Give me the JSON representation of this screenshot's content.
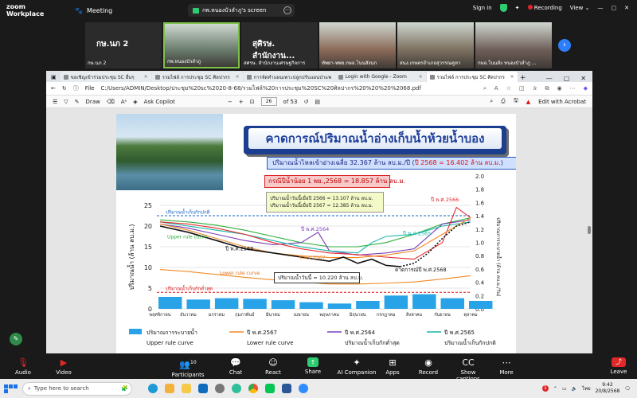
{
  "zoom": {
    "logo_line1": "zoom",
    "logo_line2": "Workplace",
    "meeting_label": "Meeting",
    "screen_pill": "กพ.หนองบัวลำภู's screen",
    "screen_pill_more": "⋯",
    "sign_in": "Sign in",
    "recording": "Recording",
    "view": "View",
    "next_arrow": "›"
  },
  "participants": [
    {
      "name": "กษ.นภ 2",
      "big": "กษ.นภ 2",
      "cam": false
    },
    {
      "name": "กพ.หนองบัวลำภู",
      "big": "",
      "cam": true,
      "active": true
    },
    {
      "name": "สศรษ. สำนักงานเศรษฐกิจการ",
      "big": "สุศิรษ. สำนักงาน...",
      "cam": false
    },
    {
      "name": "ทัพยา-ทพย.กษอ.โนนสังนก",
      "big": "",
      "cam": true
    },
    {
      "name": "สนง.เกษตรอำเภอสุวรรณคูหา",
      "big": "",
      "cam": true
    },
    {
      "name": "กษอ.โนนสัง หนองบัวลำภู ...",
      "big": "",
      "cam": true
    }
  ],
  "browser": {
    "tabs": [
      {
        "label": "ขอเชิญเข้าร่วมประชุม SC อื่นๆ",
        "active": false
      },
      {
        "label": "รวมไฟล์ การประชุม SC ศิลปากร",
        "active": false
      },
      {
        "label": "การจัดทำแผนเพาะปลูกปรับแผนป่าแพ",
        "active": false
      },
      {
        "label": "Login with Google - Zoom",
        "active": false
      },
      {
        "label": "รวมไฟล์ การประชุม SC ศิลปากร",
        "active": true
      }
    ],
    "url_label": "File",
    "url": "C:/Users/ADMIN/Desktop/ประชุม%20sc%2020-8-68/รวมไฟล์%20การประชุม%20SC%20ศิลปากร%20%20%20%2068.pdf",
    "pdf_tools": {
      "draw": "Draw",
      "copilot": "Ask Copilot",
      "page_current": "26",
      "page_total": "of 53",
      "edit_acrobat": "Edit with Acrobat"
    }
  },
  "slide": {
    "title": "คาดการณ์ปริมาณน้ำอ่างเก็บน้ำห้วยน้ำบอง",
    "inflow_note_main": "ปริมาณน้ำไหลเข้าอ่างเฉลี่ย 32.367 ล้าน ลบ.ม./ปี (",
    "inflow_note_red": "ปี 2568 = 16.402 ล้าน ลบ.ม.",
    "inflow_note_end": ")",
    "rain_note": "กรณีปีน้ำน้อย 1 พย.,2568 = 18.857 ล้าน ลบ.ม.",
    "note_2566": "ปริมาณน้ำวันนี้เมื่อปี 2566 = 13.107 ล้าน ลบ.ม.",
    "note_2567": "ปริมาณน้ำวันนี้เมื่อปี 2567 = 12.385 ล้าน ลบ.ม.",
    "today_note": "ปริมาณน้ำวันนี้ = 10.220 ล้าน ลบ.ม.",
    "label_upper_normal": "ปริมาณน้ำเก็บกักปกติ",
    "label_upper_rule": "Upper rule curve",
    "label_lower_rule": "Lower rule curve",
    "label_min": "ปริมาณน้ำเก็บกักต่ำสุด",
    "label_2568": "ปี พ.ศ.2568",
    "label_2564": "ปี พ.ศ.2564",
    "label_2567": "ปี พ.ศ.2567",
    "label_2565": "ปี พ.ศ.2565",
    "label_2566": "ปี พ.ศ.2566",
    "label_forecast": "คาดการณ์ปี พ.ศ.2568",
    "ylabel_left": "ปริมาณน้ำ (ล้าน ลบ.ม.)",
    "ylabel_right": "ปริมาณการระบายน้ำ (ล้าน ลบ.ม./วัน)",
    "legend": [
      {
        "label": "ปริมาณการระบายน้ำ",
        "color": "#29a3e8",
        "kind": "bar"
      },
      {
        "label": "ปี พ.ศ.2567",
        "color": "#f08a24",
        "kind": "line"
      },
      {
        "label": "ปี พ.ศ.2564",
        "color": "#7b3fb8",
        "kind": "line"
      },
      {
        "label": "ปี พ.ศ.2565",
        "color": "#16b7a8",
        "kind": "line"
      }
    ],
    "legend_row2": [
      "Upper rule curve",
      "Lower rule curve",
      "ปริมาณน้ำเก็บกักต่ำสุด",
      "ปริมาณน้ำเก็บกักปกติ"
    ]
  },
  "chart_data": {
    "type": "line",
    "categories": [
      "พฤศจิกายน",
      "ธันวาคม",
      "มกราคม",
      "กุมภาพันธ์",
      "มีนาคม",
      "เมษายน",
      "พฤษภาคม",
      "มิถุนายน",
      "กรกฎาคม",
      "สิงหาคม",
      "กันยายน",
      "ตุลาคม"
    ],
    "ylim": [
      0,
      25
    ],
    "y_ticks": [
      0,
      5,
      10,
      15,
      20,
      25
    ],
    "y2lim": [
      0,
      2.0
    ],
    "y2_ticks": [
      "0.0",
      "0.2",
      "0.4",
      "0.6",
      "0.8",
      "1.0",
      "1.2",
      "1.4",
      "1.6",
      "1.8",
      "2.0"
    ],
    "upper_normal_storage": 22.5,
    "min_storage": 4.0,
    "series": [
      {
        "name": "Upper rule curve",
        "color": "#2fae3c",
        "dash": false,
        "x": [
          0,
          1,
          2,
          3,
          4,
          5,
          6,
          7,
          8,
          9,
          10,
          11
        ],
        "values": [
          21.5,
          21.0,
          20.2,
          19.0,
          17.5,
          16.0,
          15.0,
          15.0,
          16.0,
          18.0,
          20.5,
          22.0
        ]
      },
      {
        "name": "Lower rule curve",
        "color": "#f08a24",
        "dash": false,
        "x": [
          0,
          1,
          2,
          3,
          4,
          5,
          6,
          7,
          8,
          9,
          10,
          11
        ],
        "values": [
          9.5,
          9.0,
          8.3,
          7.6,
          7.0,
          6.5,
          6.0,
          6.0,
          6.2,
          6.5,
          7.2,
          8.0
        ]
      },
      {
        "name": "ปี พ.ศ.2564",
        "color": "#7b3fb8",
        "dash": false,
        "x": [
          0,
          1,
          2,
          3,
          4,
          5,
          5.6,
          6,
          7,
          8,
          9,
          10,
          11
        ],
        "values": [
          20.5,
          19.5,
          18.0,
          16.5,
          15.5,
          16.0,
          18.5,
          14.0,
          13.0,
          13.5,
          14.5,
          20.5,
          21.5
        ]
      },
      {
        "name": "ปี พ.ศ.2565",
        "color": "#16b7a8",
        "dash": false,
        "x": [
          0,
          1,
          2,
          3,
          4,
          5,
          6,
          7,
          7.5,
          8,
          9,
          10,
          11
        ],
        "values": [
          21.0,
          20.0,
          19.0,
          18.0,
          16.5,
          15.0,
          14.0,
          13.5,
          16.0,
          17.5,
          18.0,
          20.0,
          21.0
        ]
      },
      {
        "name": "ปี พ.ศ.2566",
        "color": "#e8262a",
        "dash": false,
        "x": [
          0,
          1,
          2,
          3,
          4,
          5,
          6,
          7,
          8,
          9,
          10,
          10.5,
          11
        ],
        "values": [
          21.0,
          20.5,
          19.5,
          18.0,
          16.0,
          14.5,
          13.5,
          13.1,
          12.5,
          12.0,
          16.0,
          24.5,
          22.0
        ]
      },
      {
        "name": "ปี พ.ศ.2567",
        "color": "#f08a24",
        "dash": false,
        "x": [
          0,
          1,
          2,
          3,
          4,
          5,
          6,
          7,
          8,
          9,
          10,
          11
        ],
        "values": [
          20.5,
          19.0,
          17.0,
          15.0,
          13.5,
          12.8,
          12.4,
          12.4,
          13.0,
          14.0,
          18.0,
          22.0
        ]
      },
      {
        "name": "ปี พ.ศ.2568",
        "color": "#111111",
        "dash": false,
        "x": [
          0,
          1,
          2,
          3,
          4,
          5,
          6,
          6.5,
          7,
          7.5,
          8,
          8.5
        ],
        "values": [
          20.0,
          18.5,
          16.5,
          14.5,
          13.5,
          12.5,
          11.5,
          12.5,
          11.0,
          12.0,
          10.5,
          10.2
        ]
      },
      {
        "name": "คาดการณ์ปี พ.ศ.2568",
        "color": "#111111",
        "dash": true,
        "x": [
          8.5,
          9,
          9.5,
          10,
          10.5,
          11
        ],
        "values": [
          10.2,
          11.0,
          13.5,
          17.0,
          20.0,
          21.0
        ]
      }
    ],
    "release_bars": [
      0.18,
      0.14,
      0.16,
      0.15,
      0.13,
      0.1,
      0.08,
      0.12,
      0.2,
      0.22,
      0.16,
      0.12
    ]
  },
  "toolbar": {
    "audio": "Audio",
    "video": "Video",
    "participants": "Participants",
    "participants_count": "10",
    "chat": "Chat",
    "react": "React",
    "share": "Share",
    "ai": "AI Companion",
    "apps": "Apps",
    "record": "Record",
    "captions": "Show captions",
    "more": "More",
    "leave": "Leave"
  },
  "taskbar": {
    "search_placeholder": "Type here to search",
    "time": "9:42",
    "date": "20/8/2568",
    "lang": "ไทย",
    "notif": "1"
  }
}
